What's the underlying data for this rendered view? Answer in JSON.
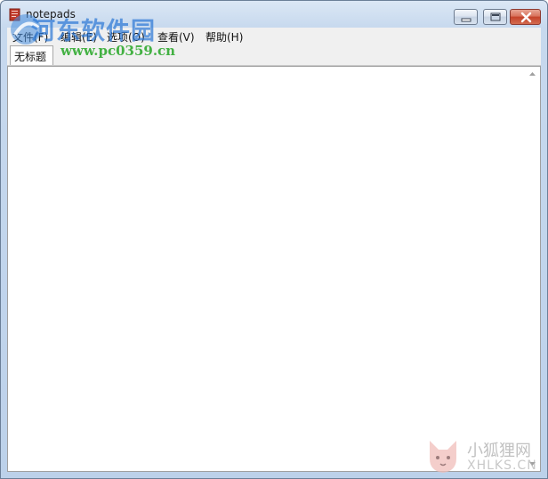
{
  "window": {
    "title": "notepads"
  },
  "menubar": {
    "items": [
      {
        "label": "文件(F)"
      },
      {
        "label": "编辑(E)"
      },
      {
        "label": "选项(O)"
      },
      {
        "label": "查看(V)"
      },
      {
        "label": "帮助(H)"
      }
    ]
  },
  "tabs": [
    {
      "label": "无标题",
      "active": true
    }
  ],
  "editor": {
    "content": ""
  },
  "watermarks": {
    "site1_name": "河东软件园",
    "site1_url": "www.pc0359.cn",
    "site2_name": "小狐狸网",
    "site2_url": "XHLKS.CN"
  },
  "icons": {
    "app": "notepad-icon",
    "minimize": "minimize-icon",
    "maximize": "maximize-icon",
    "close": "close-icon",
    "scroll_up": "scroll-up-arrow-icon",
    "scroll_down": "scroll-down-arrow-icon"
  },
  "colors": {
    "titlebar": "#c7d9ee",
    "close_button": "#c4422a",
    "menubar": "#f0f0f0",
    "editor_bg": "#ffffff"
  }
}
